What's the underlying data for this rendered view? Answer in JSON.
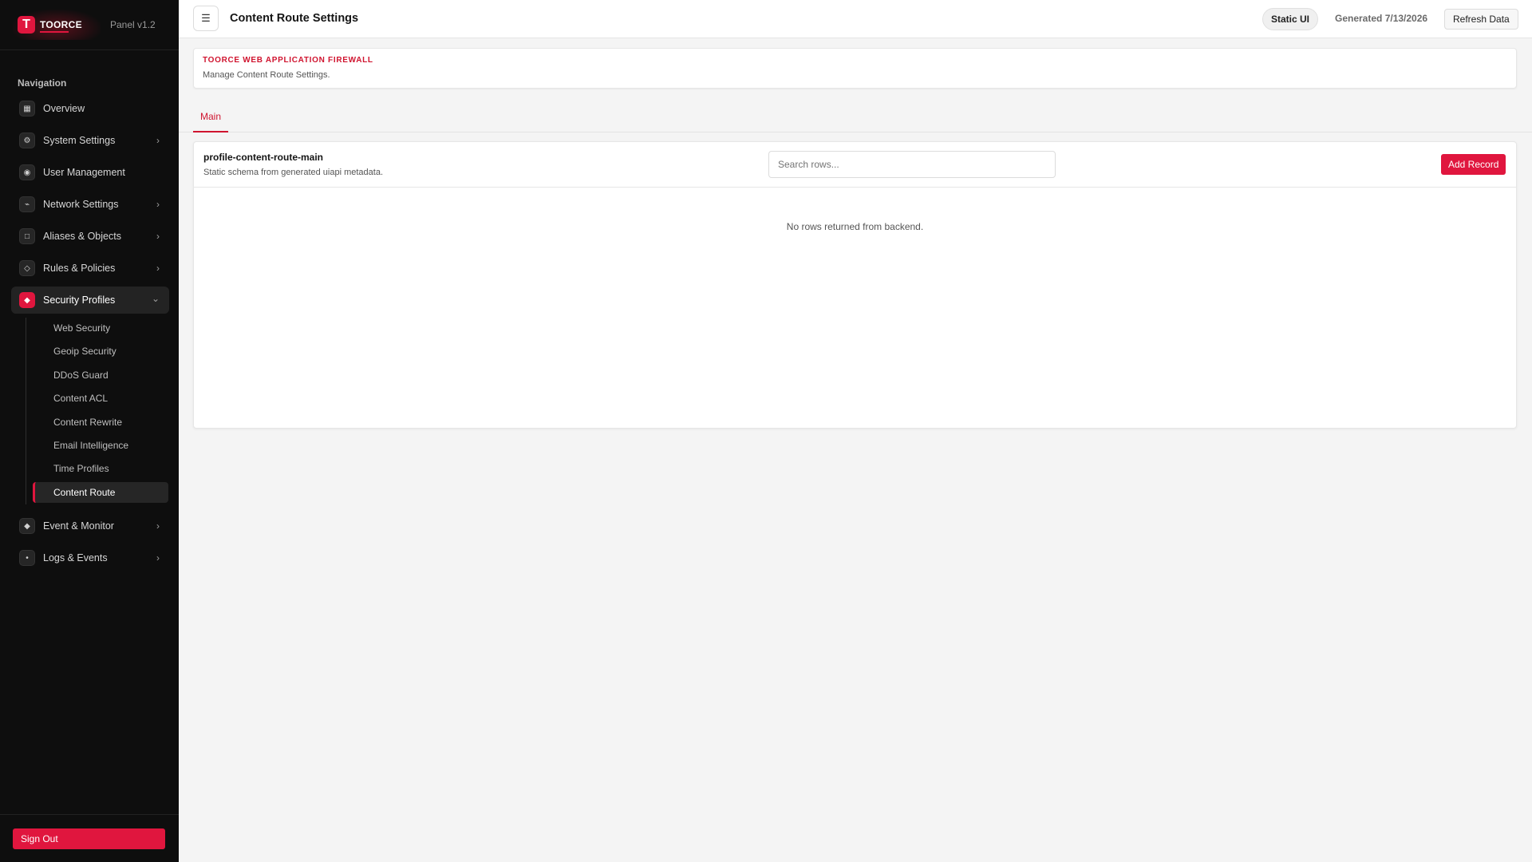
{
  "brand": {
    "logo_letter": "T",
    "name": "TOORCE",
    "version": "Panel v1.2",
    "accent_color": "#e0163e"
  },
  "sidebar": {
    "heading": "Navigation",
    "items": [
      {
        "label": "Overview",
        "icon": "grid-icon",
        "glyph": "▦"
      },
      {
        "label": "System Settings",
        "icon": "gear-icon",
        "glyph": "⚙",
        "chevron": "›"
      },
      {
        "label": "User Management",
        "icon": "user-icon",
        "glyph": "◉"
      },
      {
        "label": "Network Settings",
        "icon": "network-icon",
        "glyph": "⌁",
        "chevron": "›"
      },
      {
        "label": "Aliases & Objects",
        "icon": "square-icon",
        "glyph": "□",
        "chevron": "›"
      },
      {
        "label": "Rules & Policies",
        "icon": "diamond-outline-icon",
        "glyph": "◇",
        "chevron": "›"
      },
      {
        "label": "Security Profiles",
        "icon": "shield-icon",
        "glyph": "◆",
        "chevron": "⌄"
      },
      {
        "label": "Event & Monitor",
        "icon": "diamond-icon",
        "glyph": "◆",
        "chevron": "›"
      },
      {
        "label": "Logs & Events",
        "icon": "dot-icon",
        "glyph": "•",
        "chevron": "›"
      }
    ],
    "security_subitems": [
      {
        "label": "Web Security"
      },
      {
        "label": "Geoip Security"
      },
      {
        "label": "DDoS Guard"
      },
      {
        "label": "Content ACL"
      },
      {
        "label": "Content Rewrite"
      },
      {
        "label": "Email Intelligence"
      },
      {
        "label": "Time Profiles"
      },
      {
        "label": "Content Route"
      }
    ],
    "sign_out": "Sign Out"
  },
  "topbar": {
    "menu_glyph": "☰",
    "title": "Content Route Settings",
    "badge": "Static UI",
    "generated": "Generated 7/13/2026",
    "refresh": "Refresh Data"
  },
  "header": {
    "eyebrow": "TOORCE WEB APPLICATION FIREWALL",
    "subtitle": "Manage Content Route Settings."
  },
  "tabs": [
    {
      "label": "Main"
    }
  ],
  "table": {
    "name": "profile-content-route-main",
    "description": "Static schema from generated uiapi metadata.",
    "search_placeholder": "Search rows...",
    "search_value": "",
    "add_label": "Add Record",
    "empty_message": "No rows returned from backend."
  }
}
